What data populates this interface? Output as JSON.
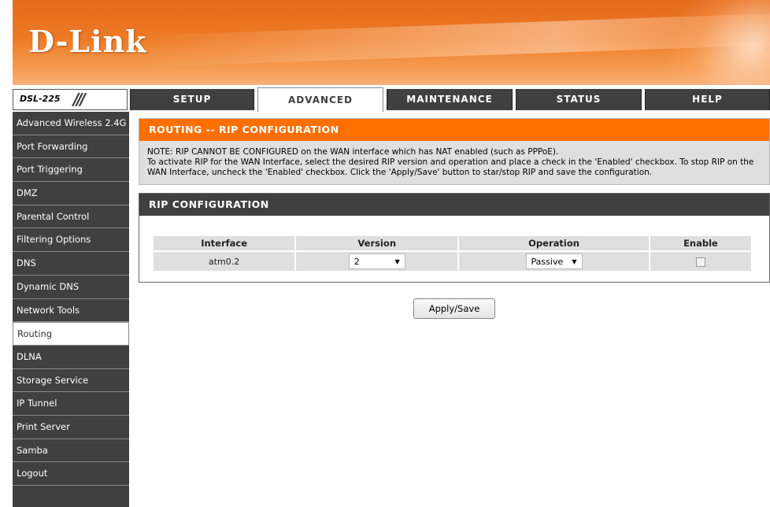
{
  "header": {
    "logo_text": "D-Link",
    "model": "DSL-225",
    "model_decoration": "///"
  },
  "tabs": [
    {
      "label": "SETUP",
      "active": false
    },
    {
      "label": "ADVANCED",
      "active": true
    },
    {
      "label": "MAINTENANCE",
      "active": false
    },
    {
      "label": "STATUS",
      "active": false
    },
    {
      "label": "HELP",
      "active": false
    }
  ],
  "sidebar": {
    "items": [
      {
        "label": "Advanced Wireless 2.4G",
        "active": false
      },
      {
        "label": "Port Forwarding",
        "active": false
      },
      {
        "label": "Port Triggering",
        "active": false
      },
      {
        "label": "DMZ",
        "active": false
      },
      {
        "label": "Parental Control",
        "active": false
      },
      {
        "label": "Filtering Options",
        "active": false
      },
      {
        "label": "DNS",
        "active": false
      },
      {
        "label": "Dynamic DNS",
        "active": false
      },
      {
        "label": "Network Tools",
        "active": false
      },
      {
        "label": "Routing",
        "active": true
      },
      {
        "label": "DLNA",
        "active": false
      },
      {
        "label": "Storage Service",
        "active": false
      },
      {
        "label": "IP Tunnel",
        "active": false
      },
      {
        "label": "Print Server",
        "active": false
      },
      {
        "label": "Samba",
        "active": false
      },
      {
        "label": "Logout",
        "active": false
      }
    ]
  },
  "routing_section": {
    "title": "ROUTING -- RIP CONFIGURATION",
    "note_line1": "NOTE: RIP CANNOT BE CONFIGURED on the WAN interface which has NAT enabled (such as PPPoE).",
    "note_line2": "To activate RIP for the WAN Interface, select the desired RIP version and operation and place a check in the 'Enabled' checkbox. To stop RIP on the WAN Interface, uncheck the 'Enabled' checkbox. Click the 'Apply/Save' button to star/stop RIP and save the configuration."
  },
  "rip_config": {
    "title": "RIP CONFIGURATION",
    "columns": [
      "Interface",
      "Version",
      "Operation",
      "Enable"
    ],
    "rows": [
      {
        "interface": "atm0.2",
        "version": "2",
        "operation": "Passive",
        "enabled": false
      }
    ]
  },
  "actions": {
    "apply_save_label": "Apply/Save"
  },
  "colors": {
    "accent_orange": "#ff6f00",
    "dark_gray": "#404040",
    "panel_gray": "#dfdfdf"
  }
}
